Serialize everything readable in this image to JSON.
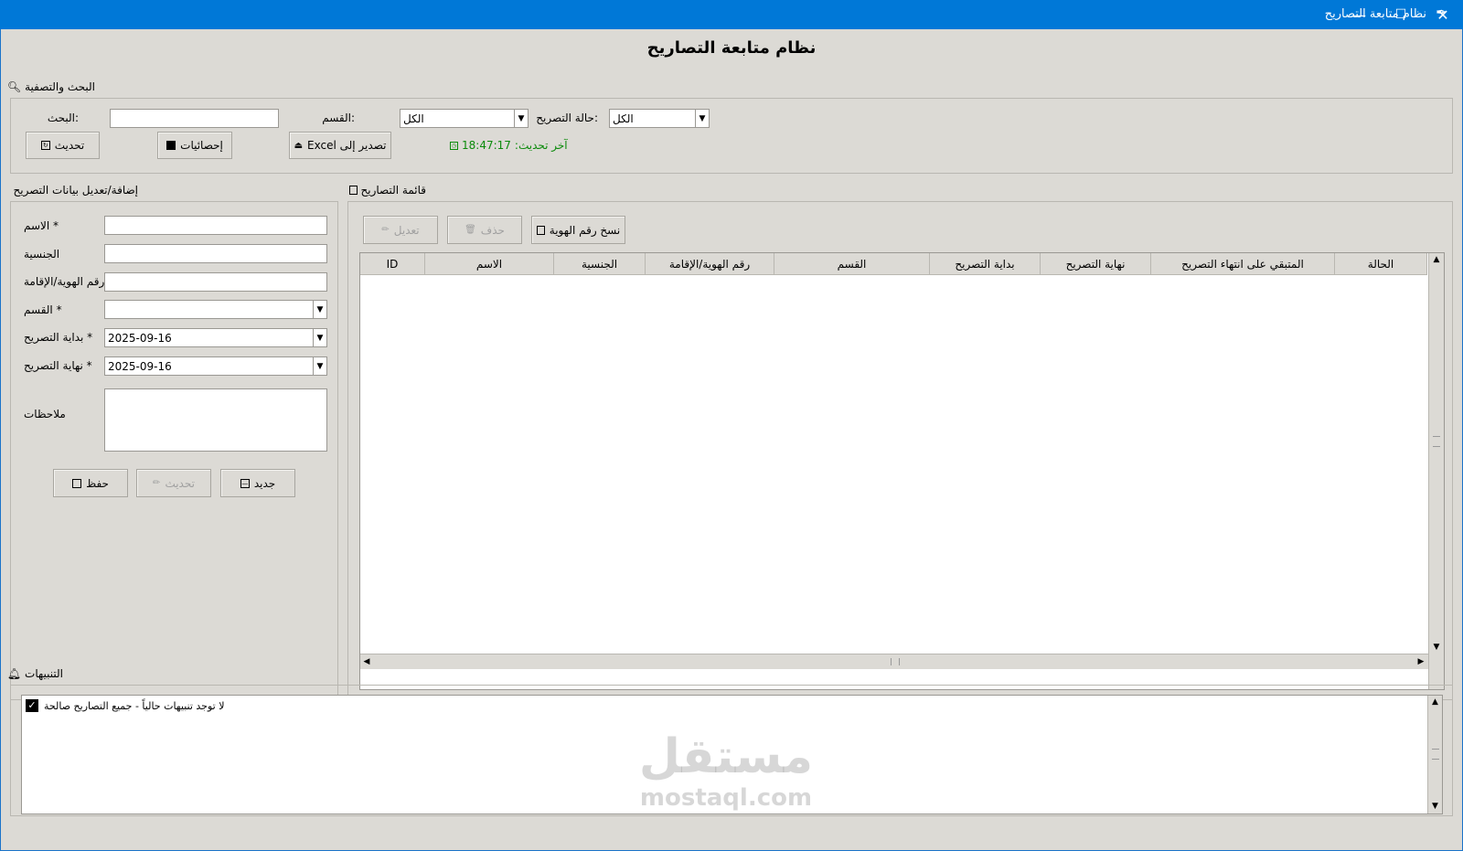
{
  "window": {
    "title": "نظام متابعة التصاريح",
    "minimize": "—",
    "maximize": "☐",
    "close": "✕"
  },
  "app_title": "نظام متابعة التصاريح",
  "search_group": {
    "label": "البحث والتصفية",
    "search_label": ":البحث",
    "search_value": "",
    "department_label": ":القسم",
    "department_value": "الكل",
    "status_label": ":حالة التصريح",
    "status_value": "الكل",
    "refresh_button": "تحديث",
    "stats_button": "إحصائيات",
    "export_button": "تصدير إلى Excel",
    "last_update_label": "آخر تحديث:",
    "last_update_time": "18:47:17"
  },
  "form_group": {
    "label": "إضافة/تعديل بيانات التصريح",
    "name_label": "* الاسم",
    "name_value": "",
    "nationality_label": "الجنسية",
    "nationality_value": "",
    "id_label": "رقم الهوية/الإقامة",
    "id_value": "",
    "department_label": "* القسم",
    "department_value": "",
    "start_label": "* بداية التصريح",
    "start_value": "2025-09-16",
    "end_label": "* نهاية التصريح",
    "end_value": "2025-09-16",
    "notes_label": "ملاحظات",
    "notes_value": "",
    "save_button": "حفظ",
    "update_button": "تحديث",
    "new_button": "جديد"
  },
  "list_group": {
    "label": "قائمة التصاريح",
    "edit_button": "تعديل",
    "delete_button": "حذف",
    "copy_id_button": "نسخ رقم الهوية",
    "columns": [
      "ID",
      "الاسم",
      "الجنسية",
      "رقم الهوية/الإقامة",
      "القسم",
      "بداية التصريح",
      "نهاية التصريح",
      "المتبقي على انتهاء التصريح",
      "الحالة"
    ],
    "rows": []
  },
  "alerts_group": {
    "label": "التنبيهات",
    "items": [
      {
        "text": "لا توجد تنبيهات حالياً - جميع التصاريح صالحة",
        "icon": "check-box-icon"
      }
    ]
  },
  "watermark": {
    "arabic": "مستقل",
    "latin": "mostaql.com"
  }
}
